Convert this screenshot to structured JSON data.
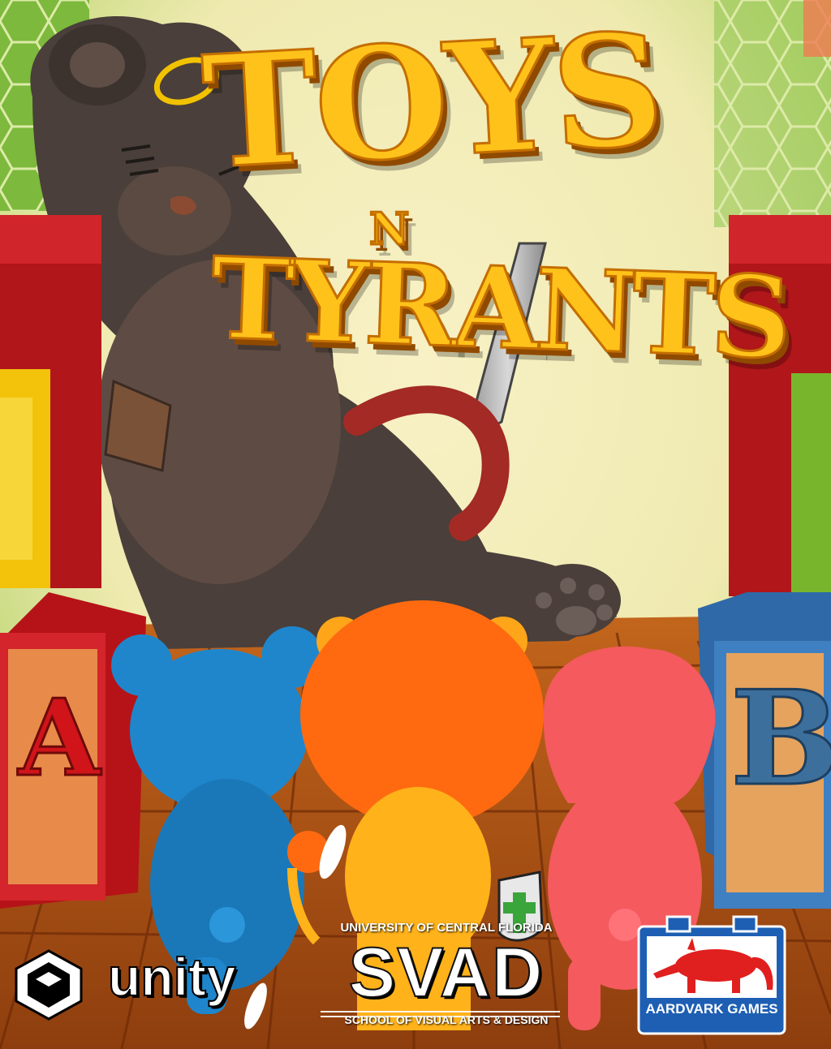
{
  "title": {
    "word1": "TOYS",
    "connector": "N",
    "word2": "TYRANTS"
  },
  "blocks": {
    "left_letter": "A",
    "right_letter": "B"
  },
  "logos": {
    "engine": {
      "name": "unity",
      "icon": "unity-cube-icon"
    },
    "school": {
      "top": "UNIVERSITY OF CENTRAL FLORIDA",
      "main": "SVAD",
      "bottom": "SCHOOL OF VISUAL ARTS & DESIGN"
    },
    "studio": {
      "name": "AARDVARK GAMES",
      "icon": "aardvark-icon"
    }
  },
  "colors": {
    "title_fill": "#FFC21A",
    "title_outline": "#C46E00",
    "blue_toy": "#1F86CC",
    "orange_toy": "#FF6A10",
    "pink_toy": "#F45A5E",
    "aardvark_red": "#E0201E",
    "aardvark_blue": "#1E5FB4"
  }
}
